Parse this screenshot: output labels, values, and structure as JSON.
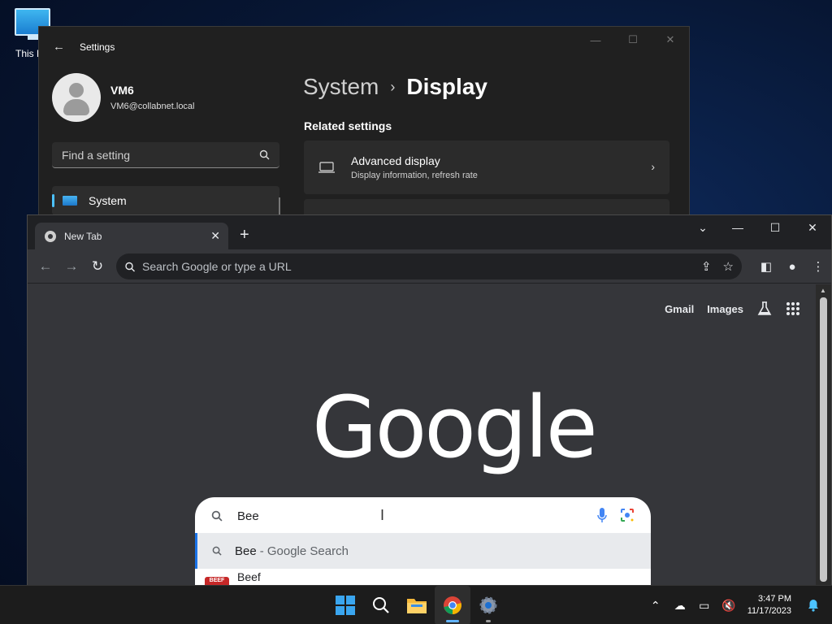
{
  "desktop": {
    "icon_label": "This PC"
  },
  "settings": {
    "title": "Settings",
    "user_name": "VM6",
    "user_email": "VM6@collabnet.local",
    "search_placeholder": "Find a setting",
    "nav_selected": "System",
    "breadcrumb_parent": "System",
    "breadcrumb_separator": "›",
    "breadcrumb_current": "Display",
    "related_heading": "Related settings",
    "card_title": "Advanced display",
    "card_subtitle": "Display information, refresh rate"
  },
  "chrome": {
    "tab_title": "New Tab",
    "omnibox_placeholder": "Search Google or type a URL",
    "links": {
      "gmail": "Gmail",
      "images": "Images"
    },
    "logo": "Google",
    "search_value": "Bee",
    "suggestion_typed": "Bee",
    "suggestion_rest": "- Google Search",
    "suggestion2_text": "Beef",
    "suggestion2_badge": "BEEF"
  },
  "taskbar": {
    "time": "3:47 PM",
    "date": "11/17/2023"
  },
  "colors": {
    "accent": "#4cc2ff",
    "chrome_dark": "#202124",
    "chrome_bg": "#35363a",
    "taskbar": "#1c1c1c"
  }
}
